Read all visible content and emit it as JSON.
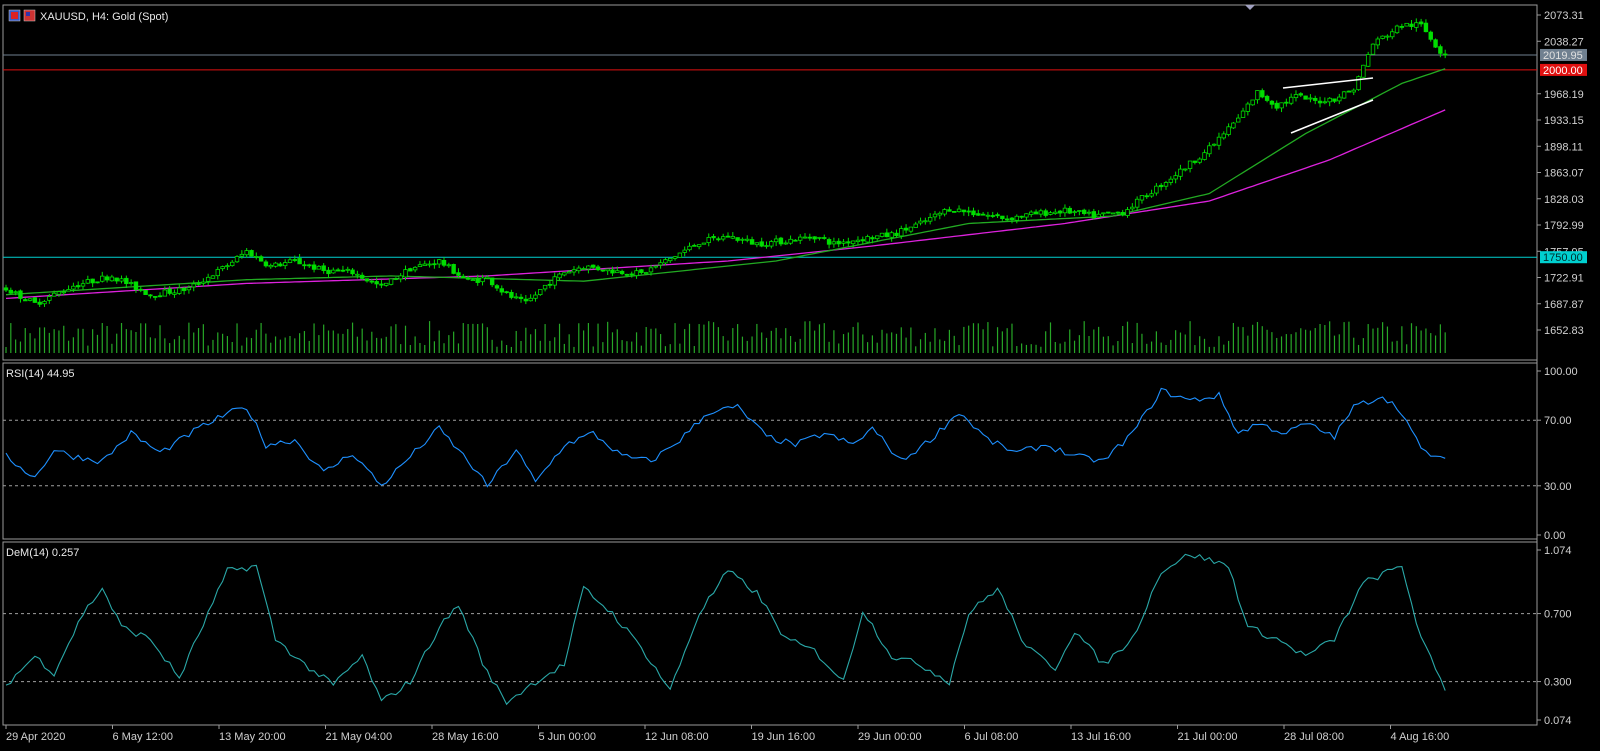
{
  "window": {
    "symbol_title": "XAUUSD, H4:  Gold (Spot)"
  },
  "colors": {
    "background": "#000000",
    "frame": "#9a9a9a",
    "bull_candle": "#00dd00",
    "bear_candle": "#00dd00",
    "volume": "#27a727",
    "ma_fast": "#22aa22",
    "ma_slow": "#dd22dd",
    "rsi_line": "#1e90ff",
    "dem_line": "#2aa8a8",
    "hline_cyan": "#00d0d0",
    "hline_red": "#e01010",
    "hline_gray": "#708090",
    "triangle": "#ffffff"
  },
  "price_panel": {
    "y_ticks": [
      "2073.31",
      "2038.27",
      "1968.19",
      "1933.15",
      "1898.11",
      "1863.07",
      "1828.03",
      "1792.99",
      "1757.95",
      "1722.91",
      "1687.87",
      "1652.83"
    ],
    "price_labels": [
      {
        "text": "2019.95",
        "kind": "gray"
      },
      {
        "text": "2000.00",
        "kind": "red"
      },
      {
        "text": "1750.00",
        "kind": "cyan"
      }
    ]
  },
  "rsi_panel": {
    "label": "RSI(14) 44.95",
    "y_ticks": [
      "100.00",
      "70.00",
      "30.00",
      "0.00"
    ]
  },
  "dem_panel": {
    "label": "DeM(14) 0.257",
    "y_ticks": [
      "1.074",
      "0.700",
      "0.300",
      "0.074"
    ]
  },
  "x_axis": {
    "labels": [
      "29 Apr 2020",
      "6 May 12:00",
      "13 May 20:00",
      "21 May 04:00",
      "28 May 16:00",
      "5 Jun 00:00",
      "12 Jun 08:00",
      "19 Jun 16:00",
      "29 Jun 00:00",
      "6 Jul 08:00",
      "13 Jul 16:00",
      "21 Jul 00:00",
      "28 Jul 08:00",
      "4 Aug 16:00"
    ]
  },
  "chart_data": [
    {
      "type": "line",
      "title": "XAUUSD, H4:  Gold (Spot)",
      "description_series": [
        "price (candles)",
        "MA fast",
        "MA slow",
        "volume"
      ],
      "ylim": [
        1652.83,
        2073.31
      ],
      "horizontal_levels": [
        2019.95,
        2000.0,
        1750.0
      ],
      "price_anchors": [
        [
          0,
          1708
        ],
        [
          6,
          1688
        ],
        [
          14,
          1712
        ],
        [
          22,
          1725
        ],
        [
          30,
          1700
        ],
        [
          38,
          1708
        ],
        [
          45,
          1735
        ],
        [
          50,
          1758
        ],
        [
          55,
          1738
        ],
        [
          60,
          1745
        ],
        [
          66,
          1732
        ],
        [
          72,
          1730
        ],
        [
          78,
          1710
        ],
        [
          84,
          1735
        ],
        [
          90,
          1745
        ],
        [
          96,
          1718
        ],
        [
          100,
          1722
        ],
        [
          104,
          1700
        ],
        [
          108,
          1688
        ],
        [
          112,
          1712
        ],
        [
          116,
          1730
        ],
        [
          120,
          1738
        ],
        [
          126,
          1732
        ],
        [
          132,
          1728
        ],
        [
          138,
          1748
        ],
        [
          144,
          1770
        ],
        [
          150,
          1778
        ],
        [
          156,
          1768
        ],
        [
          162,
          1772
        ],
        [
          168,
          1778
        ],
        [
          172,
          1768
        ],
        [
          178,
          1775
        ],
        [
          184,
          1780
        ],
        [
          190,
          1795
        ],
        [
          196,
          1815
        ],
        [
          202,
          1808
        ],
        [
          208,
          1802
        ],
        [
          214,
          1808
        ],
        [
          220,
          1812
        ],
        [
          226,
          1805
        ],
        [
          232,
          1810
        ],
        [
          238,
          1838
        ],
        [
          244,
          1865
        ],
        [
          250,
          1895
        ],
        [
          256,
          1935
        ],
        [
          260,
          1970
        ],
        [
          264,
          1952
        ],
        [
          268,
          1965
        ],
        [
          272,
          1958
        ],
        [
          276,
          1962
        ],
        [
          280,
          1975
        ],
        [
          284,
          2035
        ],
        [
          290,
          2060
        ],
        [
          294,
          2060
        ],
        [
          298,
          2025
        ],
        [
          302,
          2020
        ]
      ],
      "ma_fast_anchors": [
        [
          0,
          1700
        ],
        [
          50,
          1720
        ],
        [
          80,
          1725
        ],
        [
          120,
          1718
        ],
        [
          160,
          1745
        ],
        [
          200,
          1795
        ],
        [
          230,
          1805
        ],
        [
          250,
          1835
        ],
        [
          270,
          1915
        ],
        [
          290,
          1982
        ],
        [
          302,
          2008
        ]
      ],
      "ma_slow_anchors": [
        [
          0,
          1695
        ],
        [
          50,
          1715
        ],
        [
          100,
          1725
        ],
        [
          150,
          1745
        ],
        [
          180,
          1765
        ],
        [
          220,
          1795
        ],
        [
          250,
          1825
        ],
        [
          275,
          1880
        ],
        [
          302,
          1955
        ]
      ]
    },
    {
      "type": "line",
      "title": "RSI(14) 44.95",
      "ylim": [
        0,
        100
      ],
      "levels": [
        70,
        30
      ],
      "anchors": [
        [
          0,
          48
        ],
        [
          6,
          35
        ],
        [
          10,
          52
        ],
        [
          14,
          48
        ],
        [
          20,
          45
        ],
        [
          26,
          62
        ],
        [
          32,
          50
        ],
        [
          40,
          65
        ],
        [
          46,
          74
        ],
        [
          50,
          78
        ],
        [
          54,
          55
        ],
        [
          60,
          58
        ],
        [
          66,
          38
        ],
        [
          72,
          50
        ],
        [
          78,
          30
        ],
        [
          84,
          48
        ],
        [
          90,
          65
        ],
        [
          96,
          45
        ],
        [
          100,
          30
        ],
        [
          106,
          52
        ],
        [
          110,
          32
        ],
        [
          116,
          55
        ],
        [
          122,
          62
        ],
        [
          128,
          48
        ],
        [
          134,
          45
        ],
        [
          140,
          58
        ],
        [
          146,
          75
        ],
        [
          152,
          78
        ],
        [
          158,
          60
        ],
        [
          164,
          55
        ],
        [
          170,
          62
        ],
        [
          176,
          55
        ],
        [
          180,
          65
        ],
        [
          186,
          45
        ],
        [
          192,
          58
        ],
        [
          198,
          75
        ],
        [
          204,
          58
        ],
        [
          210,
          50
        ],
        [
          216,
          55
        ],
        [
          222,
          48
        ],
        [
          228,
          45
        ],
        [
          234,
          62
        ],
        [
          240,
          88
        ],
        [
          246,
          82
        ],
        [
          252,
          85
        ],
        [
          256,
          62
        ],
        [
          260,
          68
        ],
        [
          266,
          62
        ],
        [
          270,
          68
        ],
        [
          276,
          60
        ],
        [
          280,
          78
        ],
        [
          286,
          85
        ],
        [
          290,
          75
        ],
        [
          294,
          52
        ],
        [
          299,
          44.95
        ]
      ]
    },
    {
      "type": "line",
      "title": "DeM(14) 0.257",
      "ylim": [
        0.074,
        1.074
      ],
      "levels": [
        0.7,
        0.3
      ],
      "anchors": [
        [
          0,
          0.28
        ],
        [
          6,
          0.45
        ],
        [
          10,
          0.35
        ],
        [
          16,
          0.7
        ],
        [
          20,
          0.85
        ],
        [
          24,
          0.62
        ],
        [
          30,
          0.55
        ],
        [
          36,
          0.32
        ],
        [
          42,
          0.7
        ],
        [
          46,
          0.95
        ],
        [
          52,
          0.98
        ],
        [
          56,
          0.55
        ],
        [
          62,
          0.4
        ],
        [
          68,
          0.28
        ],
        [
          74,
          0.45
        ],
        [
          78,
          0.18
        ],
        [
          84,
          0.3
        ],
        [
          90,
          0.62
        ],
        [
          94,
          0.75
        ],
        [
          100,
          0.35
        ],
        [
          104,
          0.18
        ],
        [
          110,
          0.3
        ],
        [
          116,
          0.4
        ],
        [
          120,
          0.85
        ],
        [
          126,
          0.7
        ],
        [
          132,
          0.5
        ],
        [
          138,
          0.25
        ],
        [
          144,
          0.7
        ],
        [
          150,
          0.95
        ],
        [
          156,
          0.82
        ],
        [
          162,
          0.55
        ],
        [
          168,
          0.48
        ],
        [
          174,
          0.3
        ],
        [
          178,
          0.72
        ],
        [
          184,
          0.45
        ],
        [
          190,
          0.4
        ],
        [
          196,
          0.3
        ],
        [
          200,
          0.7
        ],
        [
          206,
          0.85
        ],
        [
          212,
          0.5
        ],
        [
          218,
          0.38
        ],
        [
          222,
          0.6
        ],
        [
          228,
          0.4
        ],
        [
          234,
          0.55
        ],
        [
          240,
          0.95
        ],
        [
          246,
          1.05
        ],
        [
          254,
          0.98
        ],
        [
          258,
          0.62
        ],
        [
          264,
          0.55
        ],
        [
          270,
          0.45
        ],
        [
          276,
          0.55
        ],
        [
          282,
          0.88
        ],
        [
          290,
          0.98
        ],
        [
          294,
          0.55
        ],
        [
          299,
          0.257
        ]
      ]
    }
  ]
}
